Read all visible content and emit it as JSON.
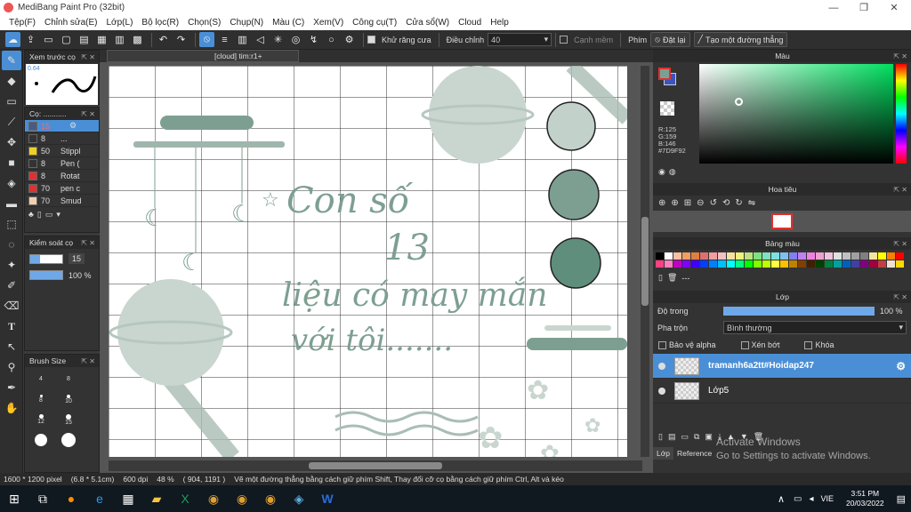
{
  "window": {
    "title": "MediBang Paint Pro (32bit)",
    "minimize": "—",
    "restore": "❐",
    "close": "✕"
  },
  "menu": [
    "Tệp(F)",
    "Chỉnh sửa(E)",
    "Lớp(L)",
    "Bộ lọc(R)",
    "Chọn(S)",
    "Chụp(N)",
    "Màu (C)",
    "Xem(V)",
    "Công cụ(T)",
    "Cửa sổ(W)",
    "Cloud",
    "Help"
  ],
  "toolbar": {
    "antialias_label": "Khử răng cưa",
    "adjust_label": "Điều chỉnh",
    "adjust_value": "40",
    "edge_label": "Cạnh mềm",
    "key_label": "Phím",
    "reset_label": "Đặt lại",
    "straight_line_label": "Tạo một đường thẳng"
  },
  "left_panels": {
    "preview_title": "Xem trước cọ",
    "preview_size": "0.64",
    "brush_title": "Cọ: ...........",
    "brushes": [
      {
        "size": "15",
        "name": "",
        "color": "#4a5a80"
      },
      {
        "size": "8",
        "name": "...",
        "color": "#333333"
      },
      {
        "size": "50",
        "name": "Stippl",
        "color": "#f0d020"
      },
      {
        "size": "8",
        "name": "Pen (",
        "color": "#333333"
      },
      {
        "size": "8",
        "name": "Rotat",
        "color": "#e03030"
      },
      {
        "size": "70",
        "name": "pen c",
        "color": "#e03030"
      },
      {
        "size": "70",
        "name": "Smud",
        "color": "#f0d0b0"
      }
    ],
    "control_title": "Kiểm soát cọ",
    "control_size": "15",
    "control_opacity": "100 %",
    "brushsize_title": "Brush Size",
    "brushsize_values": [
      "4",
      "8",
      "8",
      "10",
      "12",
      "15",
      "",
      ""
    ]
  },
  "canvas": {
    "tab_label": "[cloud] tim:r1+",
    "art_text_1": "Con số",
    "art_text_2": "13",
    "art_text_3": "liệu có may mắn",
    "art_text_4": "với tôi......."
  },
  "status": {
    "dimensions": "1600 * 1200 pixel",
    "cm": "(6.8 * 5.1cm)",
    "dpi": "600 dpi",
    "zoom": "48 %",
    "coords": "( 904, 1191 )",
    "hint": "Vẽ một đường thẳng bằng cách giữ phím Shift, Thay đổi cỡ cọ bằng cách giữ phím Ctrl, Alt và kéo"
  },
  "right": {
    "color_title": "Màu",
    "r": "R:125",
    "g": "G:159",
    "b": "B:146",
    "hex": "#7D9F92",
    "navigator_title": "Hoa tiêu",
    "palette_title": "Bảng màu",
    "palette_dots": "---",
    "layer_title": "Lớp",
    "opacity_label": "Độ trong",
    "opacity_value": "100 %",
    "blend_label": "Pha trộn",
    "blend_value": "Bình thường",
    "protect_alpha": "Bảo vệ alpha",
    "clipping": "Xén bớt",
    "lock": "Khóa",
    "layers": [
      "tramanh6a2tt#Hoidap247",
      "Lớp5"
    ],
    "tab_layer": "Lớp",
    "tab_reference": "Reference"
  },
  "watermark": {
    "line1": "Activate Windows",
    "line2": "Go to Settings to activate Windows."
  },
  "taskbar": {
    "lang": "VIE",
    "time": "3:51 PM",
    "date": "20/03/2022"
  },
  "colors": {
    "accent": "#4a8fd6",
    "art_green": "#7d9f92",
    "art_dark": "#5f8f7c"
  }
}
